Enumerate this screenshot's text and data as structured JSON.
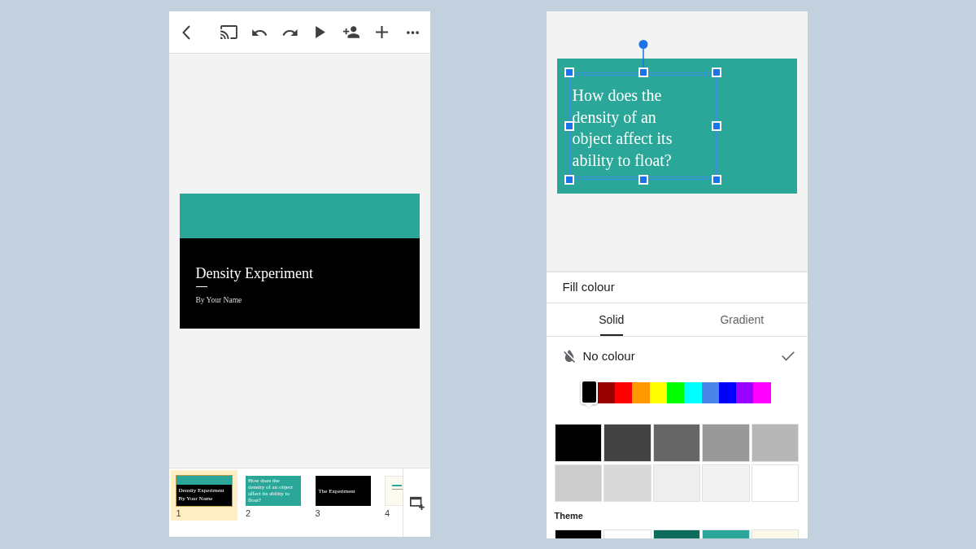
{
  "left_screen": {
    "slide": {
      "title": "Density Experiment",
      "subtitle": "By Your Name"
    },
    "filmstrip": [
      {
        "kind": "title",
        "number": "1",
        "selected": true,
        "title": "Density Experiment",
        "subtitle": "By Your Name"
      },
      {
        "kind": "question",
        "number": "2",
        "selected": false,
        "title": "How does the density of an object affect its ability to float?"
      },
      {
        "kind": "section",
        "number": "3",
        "selected": false,
        "title": "The Experiment"
      },
      {
        "kind": "light",
        "number": "4",
        "selected": false
      }
    ]
  },
  "right_screen": {
    "slide": {
      "text": "How does the density of an object affect its ability to float?"
    },
    "fill_panel": {
      "title": "Fill colour",
      "tabs": [
        {
          "label": "Solid",
          "selected": true
        },
        {
          "label": "Gradient",
          "selected": false
        }
      ],
      "no_colour": {
        "label": "No colour",
        "checked": true
      },
      "hues": [
        {
          "color": "#000000",
          "selected": true
        },
        {
          "color": "#980000",
          "selected": false
        },
        {
          "color": "#ff0000",
          "selected": false
        },
        {
          "color": "#ff9900",
          "selected": false
        },
        {
          "color": "#ffff00",
          "selected": false
        },
        {
          "color": "#00ff00",
          "selected": false
        },
        {
          "color": "#00ffff",
          "selected": false
        },
        {
          "color": "#4a86e8",
          "selected": false
        },
        {
          "color": "#0000ff",
          "selected": false
        },
        {
          "color": "#9900ff",
          "selected": false
        },
        {
          "color": "#ff00ff",
          "selected": false
        }
      ],
      "greys": [
        {
          "color": "#000000"
        },
        {
          "color": "#434343"
        },
        {
          "color": "#666666"
        },
        {
          "color": "#999999"
        },
        {
          "color": "#b7b7b7"
        },
        {
          "color": "#cccccc"
        },
        {
          "color": "#d9d9d9"
        },
        {
          "color": "#efefef"
        },
        {
          "color": "#f3f3f3"
        },
        {
          "color": "#ffffff"
        }
      ],
      "theme_label": "Theme",
      "theme": [
        {
          "color": "#000000"
        },
        {
          "color": "#ffffff"
        },
        {
          "color": "#0d6b5c"
        },
        {
          "color": "#2aa798"
        },
        {
          "color": "#fdf9e9"
        }
      ]
    }
  }
}
